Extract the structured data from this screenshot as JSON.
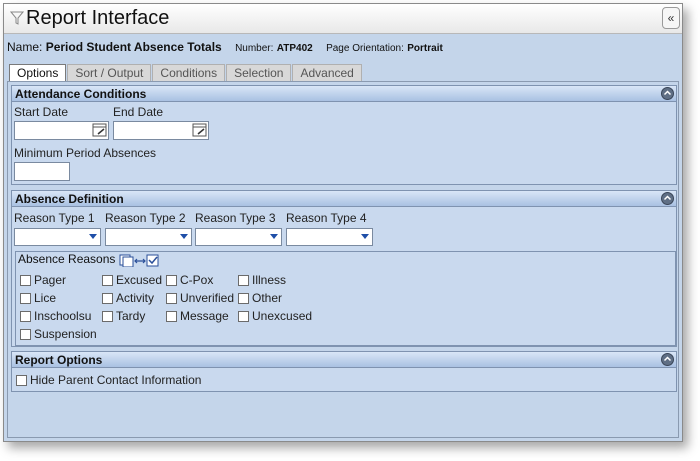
{
  "window": {
    "title": "Report Interface",
    "collapse_label": "«"
  },
  "header": {
    "name_label": "Name:",
    "name_value": "Period Student Absence Totals",
    "number_label": "Number:",
    "number_value": "ATP402",
    "orientation_label": "Page Orientation:",
    "orientation_value": "Portrait"
  },
  "tabs": [
    {
      "label": "Options",
      "active": true
    },
    {
      "label": "Sort / Output",
      "active": false
    },
    {
      "label": "Conditions",
      "active": false
    },
    {
      "label": "Selection",
      "active": false
    },
    {
      "label": "Advanced",
      "active": false
    }
  ],
  "attendance": {
    "title": "Attendance Conditions",
    "start_date_label": "Start Date",
    "start_date_value": "",
    "end_date_label": "End Date",
    "end_date_value": "",
    "min_absences_label": "Minimum Period Absences",
    "min_absences_value": ""
  },
  "absence_def": {
    "title": "Absence Definition",
    "reason_types": [
      {
        "label": "Reason Type 1",
        "value": ""
      },
      {
        "label": "Reason Type 2",
        "value": ""
      },
      {
        "label": "Reason Type 3",
        "value": ""
      },
      {
        "label": "Reason Type 4",
        "value": ""
      }
    ],
    "reasons_label": "Absence Reasons",
    "reasons": [
      {
        "label": "Pager",
        "checked": false
      },
      {
        "label": "Excused",
        "checked": false
      },
      {
        "label": "C-Pox",
        "checked": false
      },
      {
        "label": "Illness",
        "checked": false
      },
      {
        "label": "Lice",
        "checked": false
      },
      {
        "label": "Activity",
        "checked": false
      },
      {
        "label": "Unverified",
        "checked": false
      },
      {
        "label": "Other",
        "checked": false
      },
      {
        "label": "Inschoolsu",
        "checked": false
      },
      {
        "label": "Tardy",
        "checked": false
      },
      {
        "label": "Message",
        "checked": false
      },
      {
        "label": "Unexcused",
        "checked": false
      },
      {
        "label": "Suspension",
        "checked": false
      }
    ]
  },
  "report_options": {
    "title": "Report Options",
    "hide_parent_label": "Hide Parent Contact Information",
    "hide_parent_checked": false
  },
  "colors": {
    "window_bg": "#c4d5ea",
    "header_accent": "#1f4fa8",
    "section_header": "#a9c1e2"
  }
}
